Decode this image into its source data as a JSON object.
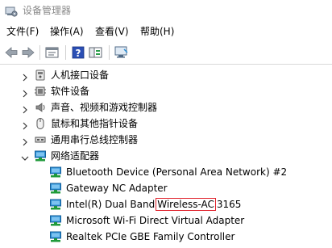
{
  "window": {
    "title": "设备管理器"
  },
  "menu": {
    "items": [
      "文件(F)",
      "操作(A)",
      "查看(V)",
      "帮助(H)"
    ]
  },
  "toolbar": {
    "help_glyph": "?"
  },
  "tree": {
    "categories": [
      {
        "label": "人机接口设备",
        "icon": "hid-icon"
      },
      {
        "label": "软件设备",
        "icon": "software-device-icon"
      },
      {
        "label": "声音、视频和游戏控制器",
        "icon": "speaker-icon"
      },
      {
        "label": "鼠标和其他指针设备",
        "icon": "mouse-icon"
      },
      {
        "label": "通用串行总线控制器",
        "icon": "usb-icon"
      },
      {
        "label": "网络适配器",
        "icon": "network-adapter-icon",
        "expanded": true
      }
    ],
    "adapters": [
      {
        "label": "Bluetooth Device (Personal Area Network) #2"
      },
      {
        "label": "Gateway NC Adapter"
      },
      {
        "label_before": "Intel(R) Dual Band",
        "label_highlight": "Wireless-AC",
        "label_after": "3165"
      },
      {
        "label": "Microsoft Wi-Fi Direct Virtual Adapter"
      },
      {
        "label": "Realtek PCIe GBE Family Controller"
      }
    ]
  },
  "colors": {
    "highlight_border": "#e0202a",
    "adapter_icon": "#2a8fd6",
    "adapter_base": "#1f9a3a"
  }
}
